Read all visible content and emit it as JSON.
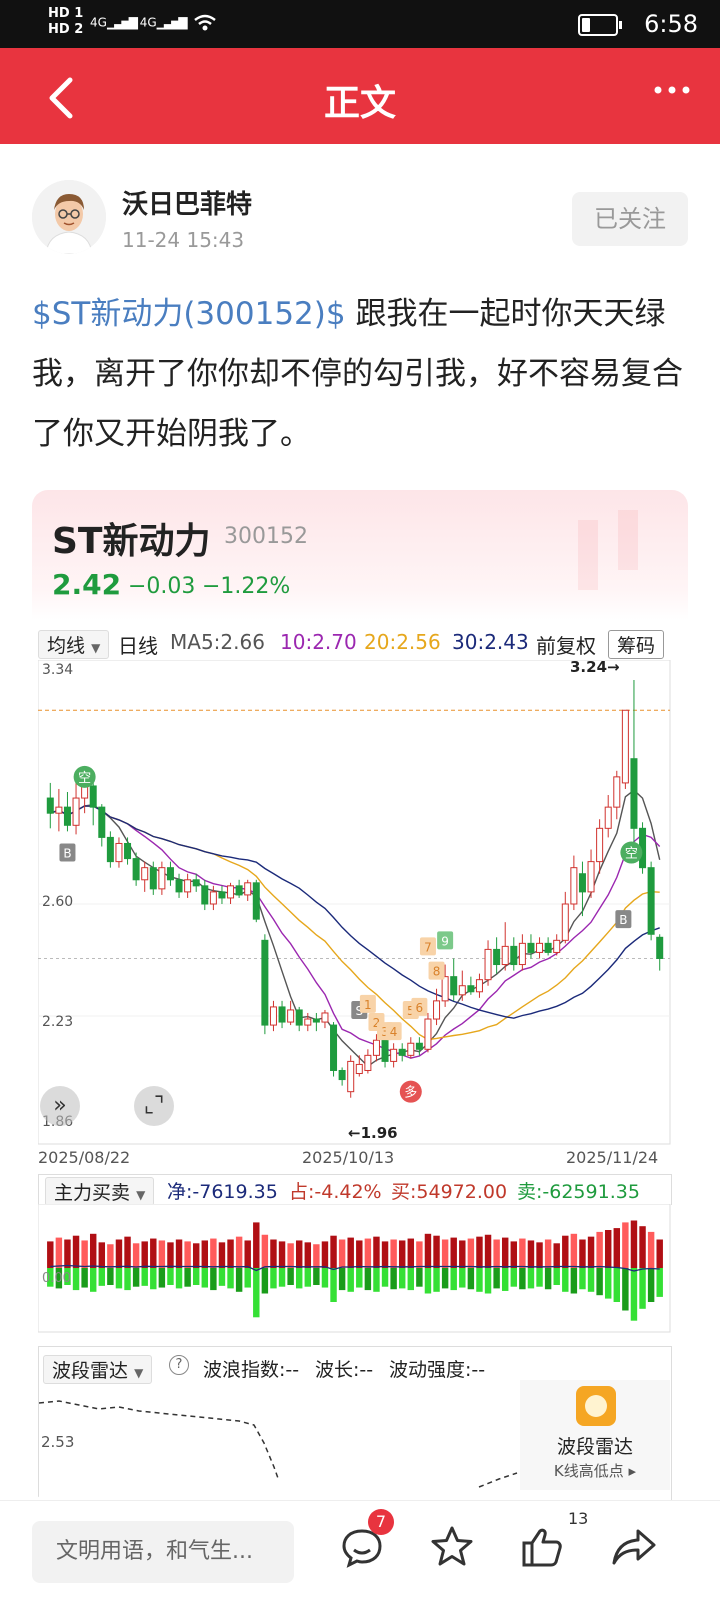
{
  "status_bar": {
    "hd1": "HD 1",
    "hd2": "HD 2",
    "net1": "4G",
    "net2": "4G",
    "time": "6:58"
  },
  "nav": {
    "title": "正文"
  },
  "author": {
    "name": "沃日巴菲特",
    "time": "11-24 15:43",
    "follow_label": "已关注"
  },
  "post": {
    "tag": "$ST新动力(300152)$",
    "text": " 跟我在一起时你天天绿我，离开了你你却不停的勾引我，好不容易复合了你又开始阴我了。"
  },
  "stock": {
    "name": "ST新动力",
    "code": "300152",
    "price": "2.42",
    "change": "−0.03",
    "change_pct": "−1.22%"
  },
  "ma_bar": {
    "dropdown": "均线",
    "period": "日线",
    "ma5": "MA5:2.66",
    "ma10": "10:2.70",
    "ma20": "20:2.56",
    "ma30": "30:2.43",
    "adjust": "前复权",
    "chip_btn": "筹码"
  },
  "kline": {
    "y_labels": [
      "3.34",
      "2.60",
      "2.23",
      "1.86"
    ],
    "dates": [
      "2025/08/22",
      "2025/10/13",
      "2025/11/24"
    ],
    "high_label": "3.24→",
    "low_label": "←1.96",
    "signals": {
      "kong": "空",
      "duo": "多",
      "b": "B",
      "s": "S"
    },
    "seq_labels": [
      "1",
      "2",
      "3",
      "4",
      "5",
      "6",
      "7",
      "8",
      "9"
    ]
  },
  "capital": {
    "dropdown": "主力买卖",
    "net": "净:-7619.35",
    "pct": "占:-4.42%",
    "buy": "买:54972.00",
    "sell": "卖:-62591.35",
    "zero_label": "0.00"
  },
  "wave": {
    "dropdown": "波段雷达",
    "help": "?",
    "index": "波浪指数:--",
    "length": "波长:--",
    "strength": "波动强度:--",
    "y_label": "2.53",
    "radar_title": "波段雷达",
    "radar_sub": "K线高低点"
  },
  "bottom_bar": {
    "comment_placeholder": "文明用语，和气生...",
    "comment_count": "7",
    "like_count": "13"
  },
  "colors": {
    "brand_red": "#e8343f",
    "up": "#d0322e",
    "down": "#1f9b3e",
    "ma5": "#555555",
    "ma10": "#9b27b0",
    "ma20": "#e6a71c",
    "ma30": "#1b2a7a",
    "link": "#4a7ec0"
  },
  "chart_data": {
    "type": "candlestick",
    "title": "ST新动力",
    "ylim": [
      1.86,
      3.34
    ],
    "x_ticks": [
      "2025/08/22",
      "2025/10/13",
      "2025/11/24"
    ],
    "candles": [
      [
        2.95,
        2.9,
        3.0,
        2.85
      ],
      [
        2.9,
        2.92,
        2.98,
        2.84
      ],
      [
        2.92,
        2.86,
        2.97,
        2.84
      ],
      [
        2.86,
        2.95,
        3.0,
        2.83
      ],
      [
        2.95,
        2.99,
        3.03,
        2.9
      ],
      [
        2.99,
        2.92,
        3.0,
        2.86
      ],
      [
        2.92,
        2.82,
        2.93,
        2.79
      ],
      [
        2.82,
        2.74,
        2.84,
        2.72
      ],
      [
        2.74,
        2.8,
        2.82,
        2.72
      ],
      [
        2.8,
        2.75,
        2.82,
        2.73
      ],
      [
        2.75,
        2.68,
        2.77,
        2.66
      ],
      [
        2.68,
        2.72,
        2.74,
        2.64
      ],
      [
        2.72,
        2.65,
        2.74,
        2.63
      ],
      [
        2.65,
        2.72,
        2.74,
        2.63
      ],
      [
        2.72,
        2.68,
        2.74,
        2.66
      ],
      [
        2.68,
        2.64,
        2.7,
        2.62
      ],
      [
        2.64,
        2.68,
        2.7,
        2.62
      ],
      [
        2.68,
        2.66,
        2.7,
        2.64
      ],
      [
        2.66,
        2.6,
        2.68,
        2.58
      ],
      [
        2.6,
        2.64,
        2.66,
        2.58
      ],
      [
        2.64,
        2.62,
        2.66,
        2.6
      ],
      [
        2.62,
        2.66,
        2.67,
        2.6
      ],
      [
        2.66,
        2.63,
        2.68,
        2.62
      ],
      [
        2.63,
        2.67,
        2.68,
        2.61
      ],
      [
        2.67,
        2.55,
        2.68,
        2.54
      ],
      [
        2.48,
        2.2,
        2.5,
        2.17
      ],
      [
        2.2,
        2.26,
        2.28,
        2.18
      ],
      [
        2.26,
        2.21,
        2.28,
        2.19
      ],
      [
        2.21,
        2.25,
        2.28,
        2.2
      ],
      [
        2.25,
        2.2,
        2.26,
        2.18
      ],
      [
        2.2,
        2.22,
        2.24,
        2.18
      ],
      [
        2.22,
        2.21,
        2.24,
        2.18
      ],
      [
        2.21,
        2.24,
        2.25,
        2.19
      ],
      [
        2.2,
        2.05,
        2.21,
        2.03
      ],
      [
        2.05,
        2.02,
        2.06,
        2.0
      ],
      [
        1.98,
        2.08,
        2.1,
        1.96
      ],
      [
        2.04,
        2.07,
        2.1,
        2.03
      ],
      [
        2.05,
        2.1,
        2.12,
        2.04
      ],
      [
        2.1,
        2.15,
        2.17,
        2.08
      ],
      [
        2.15,
        2.08,
        2.16,
        2.06
      ],
      [
        2.08,
        2.12,
        2.14,
        2.06
      ],
      [
        2.12,
        2.1,
        2.14,
        2.08
      ],
      [
        2.1,
        2.14,
        2.16,
        2.09
      ],
      [
        2.14,
        2.12,
        2.16,
        2.1
      ],
      [
        2.12,
        2.22,
        2.24,
        2.11
      ],
      [
        2.22,
        2.28,
        2.32,
        2.2
      ],
      [
        2.28,
        2.36,
        2.4,
        2.26
      ],
      [
        2.36,
        2.3,
        2.42,
        2.28
      ],
      [
        2.3,
        2.33,
        2.38,
        2.28
      ],
      [
        2.33,
        2.31,
        2.36,
        2.3
      ],
      [
        2.31,
        2.35,
        2.37,
        2.29
      ],
      [
        2.35,
        2.45,
        2.48,
        2.33
      ],
      [
        2.45,
        2.4,
        2.49,
        2.37
      ],
      [
        2.4,
        2.46,
        2.54,
        2.38
      ],
      [
        2.46,
        2.4,
        2.49,
        2.38
      ],
      [
        2.4,
        2.47,
        2.5,
        2.38
      ],
      [
        2.47,
        2.44,
        2.5,
        2.42
      ],
      [
        2.44,
        2.47,
        2.49,
        2.42
      ],
      [
        2.47,
        2.44,
        2.49,
        2.43
      ],
      [
        2.44,
        2.48,
        2.5,
        2.43
      ],
      [
        2.48,
        2.6,
        2.64,
        2.47
      ],
      [
        2.6,
        2.72,
        2.76,
        2.58
      ],
      [
        2.7,
        2.64,
        2.74,
        2.56
      ],
      [
        2.64,
        2.74,
        2.78,
        2.62
      ],
      [
        2.74,
        2.85,
        2.88,
        2.7
      ],
      [
        2.85,
        2.92,
        2.96,
        2.82
      ],
      [
        2.92,
        3.02,
        3.04,
        2.88
      ],
      [
        3.0,
        3.24,
        3.24,
        2.98
      ],
      [
        3.08,
        2.85,
        3.34,
        2.78
      ],
      [
        2.85,
        2.72,
        2.87,
        2.7
      ],
      [
        2.72,
        2.5,
        2.74,
        2.48
      ],
      [
        2.49,
        2.42,
        2.5,
        2.38
      ]
    ],
    "ma5_last": 2.66,
    "ma10_last": 2.7,
    "ma20_last": 2.56,
    "ma30_last": 2.43
  }
}
